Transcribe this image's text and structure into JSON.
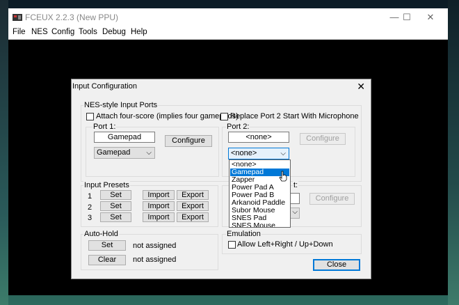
{
  "window": {
    "title": "FCEUX 2.2.3 (New PPU)",
    "minimize": "—",
    "maximize": "☐",
    "close": "✕"
  },
  "menu": [
    "File",
    "NES",
    "Config",
    "Tools",
    "Debug",
    "Help"
  ],
  "dialog": {
    "title": "Input Configuration",
    "close": "✕",
    "nes_ports": {
      "label": "NES-style Input Ports",
      "four_score": "Attach four-score (implies four gamepads)",
      "replace_port2": "Replace Port 2 Start With Microphone",
      "port1": {
        "label": "Port 1:",
        "device": "Gamepad",
        "configure": "Configure",
        "combo": "Gamepad"
      },
      "port2": {
        "label": "Port 2:",
        "device": "<none>",
        "configure": "Configure",
        "combo": "<none>"
      }
    },
    "dropdown_options": [
      "<none>",
      "Gamepad",
      "Zapper",
      "Power Pad A",
      "Power Pad B",
      "Arkanoid Paddle",
      "Subor Mouse",
      "SNES Pad",
      "SNES Mouse"
    ],
    "dropdown_selected": "Gamepad",
    "presets": {
      "label": "Input Presets",
      "rows": [
        {
          "num": "1",
          "set": "Set",
          "import": "Import",
          "export": "Export"
        },
        {
          "num": "2",
          "set": "Set",
          "import": "Import",
          "export": "Export"
        },
        {
          "num": "3",
          "set": "Set",
          "import": "Import",
          "export": "Export"
        }
      ]
    },
    "famicom": {
      "label_tail": "t:",
      "configure": "Configure"
    },
    "autohold": {
      "label": "Auto-Hold",
      "set": "Set",
      "clear": "Clear",
      "set_status": "not assigned",
      "clear_status": "not assigned"
    },
    "emulation": {
      "label": "Emulation",
      "allow_lr": "Allow Left+Right / Up+Down"
    },
    "close_button": "Close"
  },
  "colors": {
    "selection": "#0078d7",
    "default_button_border": "#0078d7"
  }
}
